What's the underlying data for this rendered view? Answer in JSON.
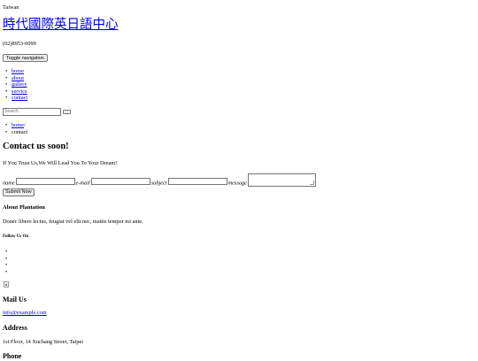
{
  "header": {
    "region": "Taiwan",
    "brand": "時代國際英日語中心",
    "phone": "(02)8953-0099",
    "toggle_label": "Toggle navigation"
  },
  "nav": {
    "items": [
      {
        "label": "home"
      },
      {
        "label": "about"
      },
      {
        "label": "gallery"
      },
      {
        "label": "service"
      },
      {
        "label": "contact"
      }
    ]
  },
  "search": {
    "placeholder": "Search"
  },
  "breadcrumb": {
    "home": "home",
    "separator": "/",
    "current": "contact"
  },
  "contact": {
    "heading": "Contact us soon!",
    "tagline": "If You Trust Us,We Will Lead You To Your Dream!",
    "form": {
      "name_label": "name",
      "email_label": "e-mail",
      "subject_label": "subject",
      "message_label": "message",
      "submit_label": "Submit Now"
    }
  },
  "footer": {
    "about_heading": "About Plantation",
    "about_text": "Donec libero lectus, feugiat vel elit nec, mattis tempor mi ante.",
    "follow_heading": "Follow Us On",
    "social_count": 4,
    "mail_heading": "Mail Us",
    "mail": "info@example.com",
    "address_heading": "Address",
    "address": "1st Floor, 14 Xuchang Street, Taipei",
    "phone_heading": "Phone"
  }
}
